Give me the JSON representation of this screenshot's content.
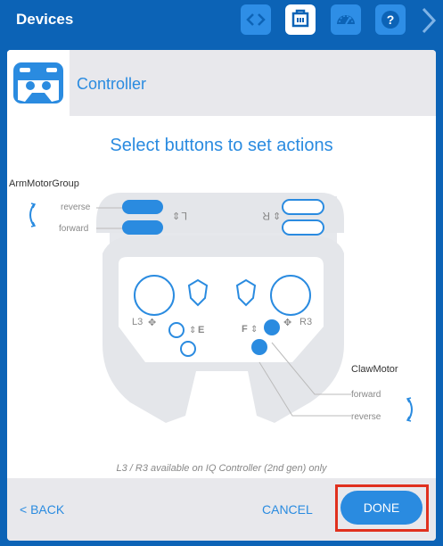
{
  "topbar": {
    "title": "Devices",
    "buttons": [
      {
        "icon": "code-icon"
      },
      {
        "icon": "device-port-icon",
        "active": true
      },
      {
        "icon": "dashboard-gauge-icon"
      },
      {
        "icon": "help-icon",
        "text": "?"
      }
    ],
    "next_icon": "chevron-right-icon"
  },
  "header": {
    "title": "Controller",
    "icon": "gamepad-icon"
  },
  "heading": "Select buttons to set actions",
  "left_group": {
    "name": "ArmMotorGroup",
    "labels": [
      "reverse",
      "forward"
    ]
  },
  "right_group": {
    "name": "ClawMotor",
    "labels": [
      "forward",
      "reverse"
    ]
  },
  "controller": {
    "l_label": "L",
    "r_label": "R",
    "l3_label": "L3",
    "r3_label": "R3",
    "e_label": "E",
    "f_label": "F"
  },
  "note": "L3 / R3 available on IQ Controller (2nd gen) only",
  "footer": {
    "back": "< BACK",
    "cancel": "CANCEL",
    "done": "DONE"
  },
  "colors": {
    "brand": "#0c63b6",
    "accent": "#2a8be0",
    "highlight": "#e0301e",
    "panel_gray": "#e8e8ec"
  }
}
